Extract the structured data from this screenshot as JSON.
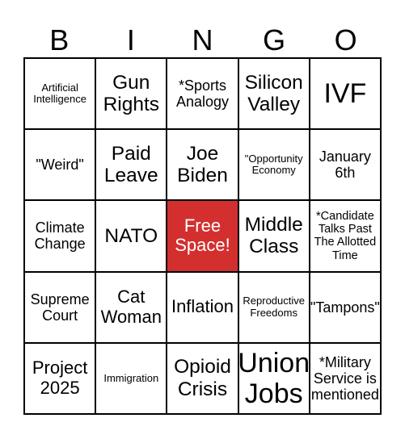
{
  "header": [
    "B",
    "I",
    "N",
    "G",
    "O"
  ],
  "free_color": "#D32F2F",
  "cells": [
    {
      "text": "Artificial Intelligence",
      "size": "s13"
    },
    {
      "text": "Gun Rights",
      "size": "s24"
    },
    {
      "text": "*Sports Analogy",
      "size": "s17"
    },
    {
      "text": "Silicon Valley",
      "size": "s24"
    },
    {
      "text": "IVF",
      "size": "s32"
    },
    {
      "text": "\"Weird\"",
      "size": "s17"
    },
    {
      "text": "Paid Leave",
      "size": "s24"
    },
    {
      "text": "Joe Biden",
      "size": "s24"
    },
    {
      "text": "\"Opportunity Economy",
      "size": "s13"
    },
    {
      "text": "January 6th",
      "size": "s17"
    },
    {
      "text": "Climate Change",
      "size": "s17"
    },
    {
      "text": "NATO",
      "size": "s24"
    },
    {
      "text": "Free Space!",
      "size": "s22",
      "free": true
    },
    {
      "text": "Middle Class",
      "size": "s24"
    },
    {
      "text": "*Candidate Talks Past The Allotted Time",
      "size": "s14"
    },
    {
      "text": "Supreme Court",
      "size": "s17"
    },
    {
      "text": "Cat Woman",
      "size": "s22"
    },
    {
      "text": "Inflation",
      "size": "s22"
    },
    {
      "text": "Reproductive Freedoms",
      "size": "s13"
    },
    {
      "text": "\"Tampons\"",
      "size": "s17"
    },
    {
      "text": "Project 2025",
      "size": "s22"
    },
    {
      "text": "Immigration",
      "size": "s13"
    },
    {
      "text": "Opioid Crisis",
      "size": "s24"
    },
    {
      "text": "Union Jobs",
      "size": "s32"
    },
    {
      "text": "*Military Service is mentioned",
      "size": "s17"
    }
  ]
}
